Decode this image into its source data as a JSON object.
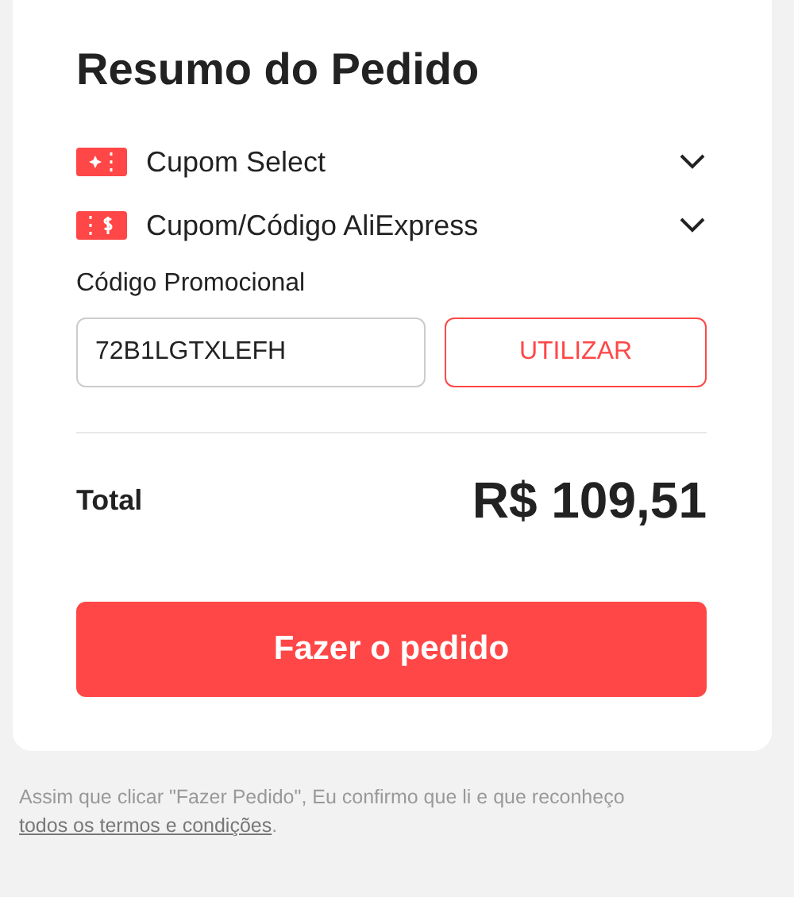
{
  "title": "Resumo do Pedido",
  "coupons": [
    {
      "kind": "select",
      "label": "Cupom Select",
      "expanded": false
    },
    {
      "kind": "code",
      "label": "Cupom/Código AliExpress",
      "expanded": false
    }
  ],
  "promo": {
    "label": "Código Promocional",
    "value": "72B1LGTXLEFH",
    "button": "UTILIZAR"
  },
  "total": {
    "label": "Total",
    "amount": "R$ 109,51"
  },
  "order_button": "Fazer o pedido",
  "notice": {
    "text": "Assim que clicar \"Fazer Pedido\", Eu confirmo que li e que reconheço",
    "link": "todos os termos e condições",
    "end": "."
  }
}
